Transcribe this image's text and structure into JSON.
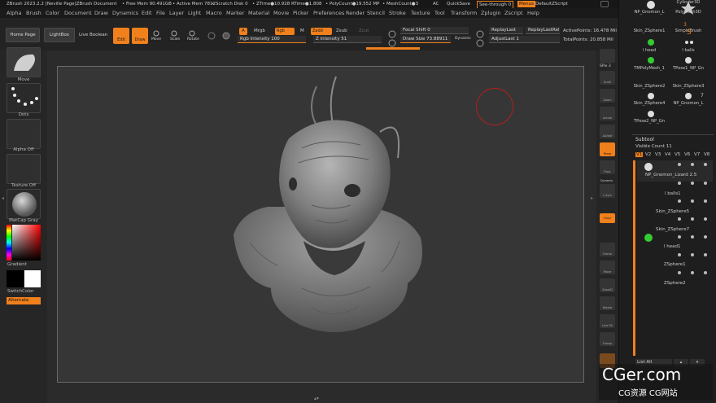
{
  "titlebar": {
    "app": "ZBrush 2023.2.2 [Neville Page]ZBrush Document",
    "free_mem": "• Free Mem 90.491GB",
    "active_mem": "• Active Mem 7812",
    "scratch": "• Scratch Disk 0",
    "ztime": "• ZTime●10.928 RTime●1.808",
    "polycount": "• PolyCount●19.552 MP",
    "meshcount": "• MeshCount●3",
    "ac": "AC",
    "quicksave": "QuickSave",
    "seethrough": "See-through  0",
    "menus": "Menus",
    "script": "DefaultZScript"
  },
  "menubar": [
    "Alpha",
    "Brush",
    "Color",
    "Document",
    "Draw",
    "Dynamics",
    "Edit",
    "File",
    "Layer",
    "Light",
    "Macro",
    "Marker",
    "Material",
    "Movie",
    "Picker",
    "Preferences",
    "Render",
    "Stencil",
    "Stroke",
    "Texture",
    "Tool",
    "Transform",
    "Zplugin",
    "Zscript",
    "Help"
  ],
  "topshelf": {
    "home_page": "Home Page",
    "lightbox": "LightBox",
    "live_boolean": "Live Boolean",
    "tools": [
      "Edit",
      "Draw",
      "Move",
      "Scale",
      "Rotate"
    ],
    "a": "A",
    "mrgb": "Mrgb",
    "rgb": "Rgb",
    "m": "M",
    "zadd": "Zadd",
    "zsub": "Zsub",
    "zcut": "Zcut",
    "rgb_intensity": "Rgb Intensity 100",
    "z_intensity": "Z Intensity 51",
    "focal_shift": "Focal Shift 0",
    "draw_size": "Draw Size 73.88911",
    "dynamic": "Dynamic",
    "replay_last": "ReplayLast",
    "replay_last_rel": "ReplayLastRel",
    "adjust_last": "AdjustLast 1",
    "active_points": "ActivePoints: 16.478 Mil",
    "total_points": "TotalPoints: 20.858 Mil"
  },
  "leftshelf": {
    "brush": "Move",
    "stroke": "Dots",
    "alpha": "Alpha Off",
    "texture": "Texture Off",
    "material": "MatCap Gray",
    "gradient": "Gradient",
    "switch_color": "SwitchColor",
    "alternate": "Alternate"
  },
  "rightshelf": [
    "SPix 3",
    "Scroll",
    "Zoom",
    "Actual",
    "AAHalf",
    "Persp",
    "Floor",
    "Dynamic",
    "L.Sym",
    "Gxyz",
    "Frame",
    "Move",
    "ZoomD",
    "Rotate",
    "Line Fill",
    "Transp"
  ],
  "tray": {
    "tools": [
      {
        "label": "NP_Gnomon_L"
      },
      {
        "label": "Cylinder3D"
      },
      {
        "label": "PolyMesh3D"
      },
      {
        "label": "Skin_ZSphere1"
      },
      {
        "label": "SimpleBrush"
      },
      {
        "label": "l head"
      },
      {
        "label": "l balls"
      },
      {
        "label": "TMPolyMesh_1"
      },
      {
        "label": "TPose1_NP_Gn"
      },
      {
        "label": "Skin_ZSphere2"
      },
      {
        "label": "Skin_ZSphere3"
      },
      {
        "label": "Skin_ZSphere4"
      },
      {
        "label": "NP_Gnomon_L"
      },
      {
        "label": "TPose2_NP_Gn"
      }
    ],
    "badge_3": "3",
    "badge_7": "7",
    "subtool_title": "Subtool",
    "visible_count": "Visible Count 11",
    "versions": [
      "V1",
      "V2",
      "V3",
      "V4",
      "V5",
      "V6",
      "V7",
      "V8"
    ],
    "subtools": [
      "NP_Gnomon_Lizard 2.5",
      "l balls1",
      "Skin_ZSphere5",
      "Skin_ZSphere7",
      "l head1",
      "ZSphere1",
      "ZSphere2"
    ],
    "list_all": "List All"
  },
  "watermark": {
    "line1": "CGer.com",
    "line2": "CG资源 CG网站"
  },
  "colors": {
    "accent": "#f0801c",
    "cursor_ring": "#b02020"
  }
}
